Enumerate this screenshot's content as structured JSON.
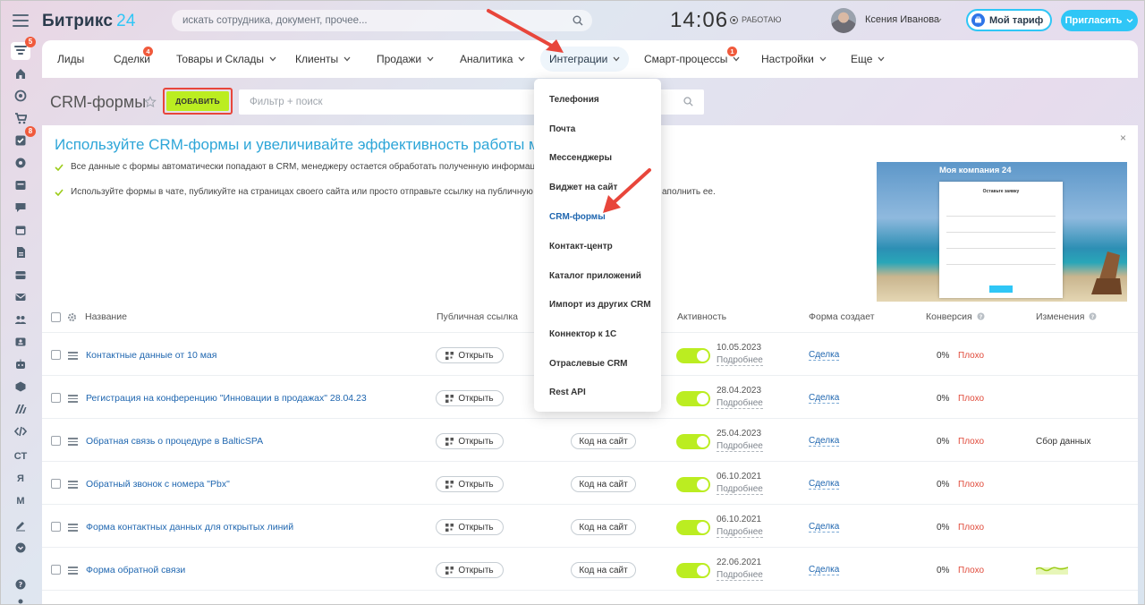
{
  "header": {
    "logo_main": "Битрикс",
    "logo_num": "24",
    "search_placeholder": "искать сотрудника, документ, прочее...",
    "clock": "14:06",
    "work_status": "РАБОТАЮ",
    "user_name": "Ксения Иванова",
    "tariff_label": "Мой тариф",
    "invite_label": "Пригласить"
  },
  "sidebar": {
    "items": [
      {
        "icon": "filter-icon",
        "badge": "5"
      },
      {
        "icon": "home-icon",
        "badge": ""
      },
      {
        "icon": "target-icon",
        "badge": ""
      },
      {
        "icon": "cart-icon",
        "badge": ""
      },
      {
        "icon": "tasks-icon",
        "badge": "8"
      },
      {
        "icon": "puzzle-icon",
        "badge": ""
      },
      {
        "icon": "drive-icon",
        "badge": ""
      },
      {
        "icon": "chat-icon",
        "badge": ""
      },
      {
        "icon": "calendar-icon",
        "badge": ""
      },
      {
        "icon": "document-icon",
        "badge": ""
      },
      {
        "icon": "inbox-icon",
        "badge": ""
      },
      {
        "icon": "mail-icon",
        "badge": ""
      },
      {
        "icon": "group-icon",
        "badge": ""
      },
      {
        "icon": "contact-card-icon",
        "badge": ""
      },
      {
        "icon": "robot-icon",
        "badge": ""
      },
      {
        "icon": "box-icon",
        "badge": ""
      },
      {
        "icon": "brand-m-icon",
        "badge": ""
      },
      {
        "icon": "code-icon",
        "badge": ""
      }
    ],
    "text_items": [
      "СТ",
      "Я",
      "М"
    ],
    "bottom_icons": [
      "pen-icon",
      "chevron-circle-icon",
      "help-icon",
      "user-icon"
    ]
  },
  "nav": {
    "items": [
      {
        "label": "Лиды",
        "badge": ""
      },
      {
        "label": "Сделки",
        "badge": "4"
      },
      {
        "label": "Товары и Склады",
        "badge": ""
      },
      {
        "label": "Клиенты",
        "badge": ""
      },
      {
        "label": "Продажи",
        "badge": ""
      },
      {
        "label": "Аналитика",
        "badge": ""
      },
      {
        "label": "Интеграции",
        "badge": ""
      },
      {
        "label": "Смарт-процессы",
        "badge": "1"
      },
      {
        "label": "Настройки",
        "badge": ""
      },
      {
        "label": "Еще",
        "badge": ""
      }
    ]
  },
  "page": {
    "title": "CRM-формы",
    "add_label": "ДОБАВИТЬ",
    "filter_placeholder": "Фильтр + поиск"
  },
  "banner": {
    "title": "Используйте CRM-формы и увеличивайте эффективность работы менедже",
    "line1": "Все данные с формы автоматически попадают в CRM, менеджеру остается обработать полученную информацию у",
    "line2": "Используйте формы в чате, публикуйте на страницах своего сайта или просто отправьте ссылку на публичную стра",
    "line2_tail": "аполнить ее.",
    "close": "×",
    "promo_title": "Моя компания",
    "promo_num": "24",
    "promo_form_title": "Оставьте заявку"
  },
  "dropdown": {
    "items": [
      "Телефония",
      "Почта",
      "Мессенджеры",
      "Виджет на сайт",
      "CRM-формы",
      "Контакт-центр",
      "Каталог приложений",
      "Импорт из других CRM",
      "Коннектор к 1С",
      "Отраслевые CRM",
      "Rest API"
    ]
  },
  "table": {
    "headers": {
      "name": "Название",
      "public_link": "Публичная ссылка",
      "activity": "Активность",
      "creates": "Форма создает",
      "conversion": "Конверсия",
      "changes": "Изменения"
    },
    "open_label": "Открыть",
    "code_label": "Код на сайт",
    "more_label": "Подробнее",
    "rows": [
      {
        "name": "Контактные данные от 10 мая",
        "code": false,
        "date": "10.05.2023",
        "creates": "Сделка",
        "conversion": "0%",
        "rating": "Плохо",
        "changes": ""
      },
      {
        "name": "Регистрация на конференцию \"Инновации в продажах\" 28.04.23",
        "code": false,
        "date": "28.04.2023",
        "creates": "Сделка",
        "conversion": "0%",
        "rating": "Плохо",
        "changes": ""
      },
      {
        "name": "Обратная связь о процедуре в BalticSPA",
        "code": true,
        "date": "25.04.2023",
        "creates": "Сделка",
        "conversion": "0%",
        "rating": "Плохо",
        "changes": "Сбор данных"
      },
      {
        "name": "Обратный звонок с номера \"Pbx\"",
        "code": true,
        "date": "06.10.2021",
        "creates": "Сделка",
        "conversion": "0%",
        "rating": "Плохо",
        "changes": ""
      },
      {
        "name": "Форма контактных данных для открытых линий",
        "code": true,
        "date": "06.10.2021",
        "creates": "Сделка",
        "conversion": "0%",
        "rating": "Плохо",
        "changes": ""
      },
      {
        "name": "Форма обратной связи",
        "code": true,
        "date": "22.06.2021",
        "creates": "Сделка",
        "conversion": "0%",
        "rating": "Плохо",
        "changes": ""
      }
    ]
  },
  "colors": {
    "accent": "#2fc6f6",
    "link": "#2067b0",
    "add_button": "#bbed21",
    "badge": "#f05a3c",
    "annotation": "#e8463b"
  }
}
